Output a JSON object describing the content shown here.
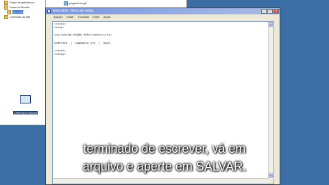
{
  "explorer": {
    "tree_items": [
      {
        "label": "Pasta de aplicativos",
        "selected": false
      },
      {
        "label": "Pasta do Mozilla",
        "selected": false
      },
      {
        "label": "Meu Site",
        "selected": true
      },
      {
        "label": "Conteúdo do site",
        "selected": false
      }
    ],
    "file_item": "pagemenor.gif"
  },
  "desktop_icon": {
    "label": "Certificado Whonar"
  },
  "notepad": {
    "title": "teste.html - Bloco de notas",
    "menu": [
      "Arquivo",
      "Editar",
      "Formatar",
      "Exibir",
      "Ajuda"
    ],
    "lines": [
      "</html>",
      "<body>",
      "",
      "<h1><center>SOBRE MIM</center></h1>",
      "",
      "COMPUTER  |  ENDEREÇO IPS  |  MACS",
      "",
      "</html>",
      "</body>"
    ]
  },
  "subtitle": {
    "line1": "terminado de escrever, vá em",
    "line2": "arquivo e aperte em SALVAR."
  }
}
